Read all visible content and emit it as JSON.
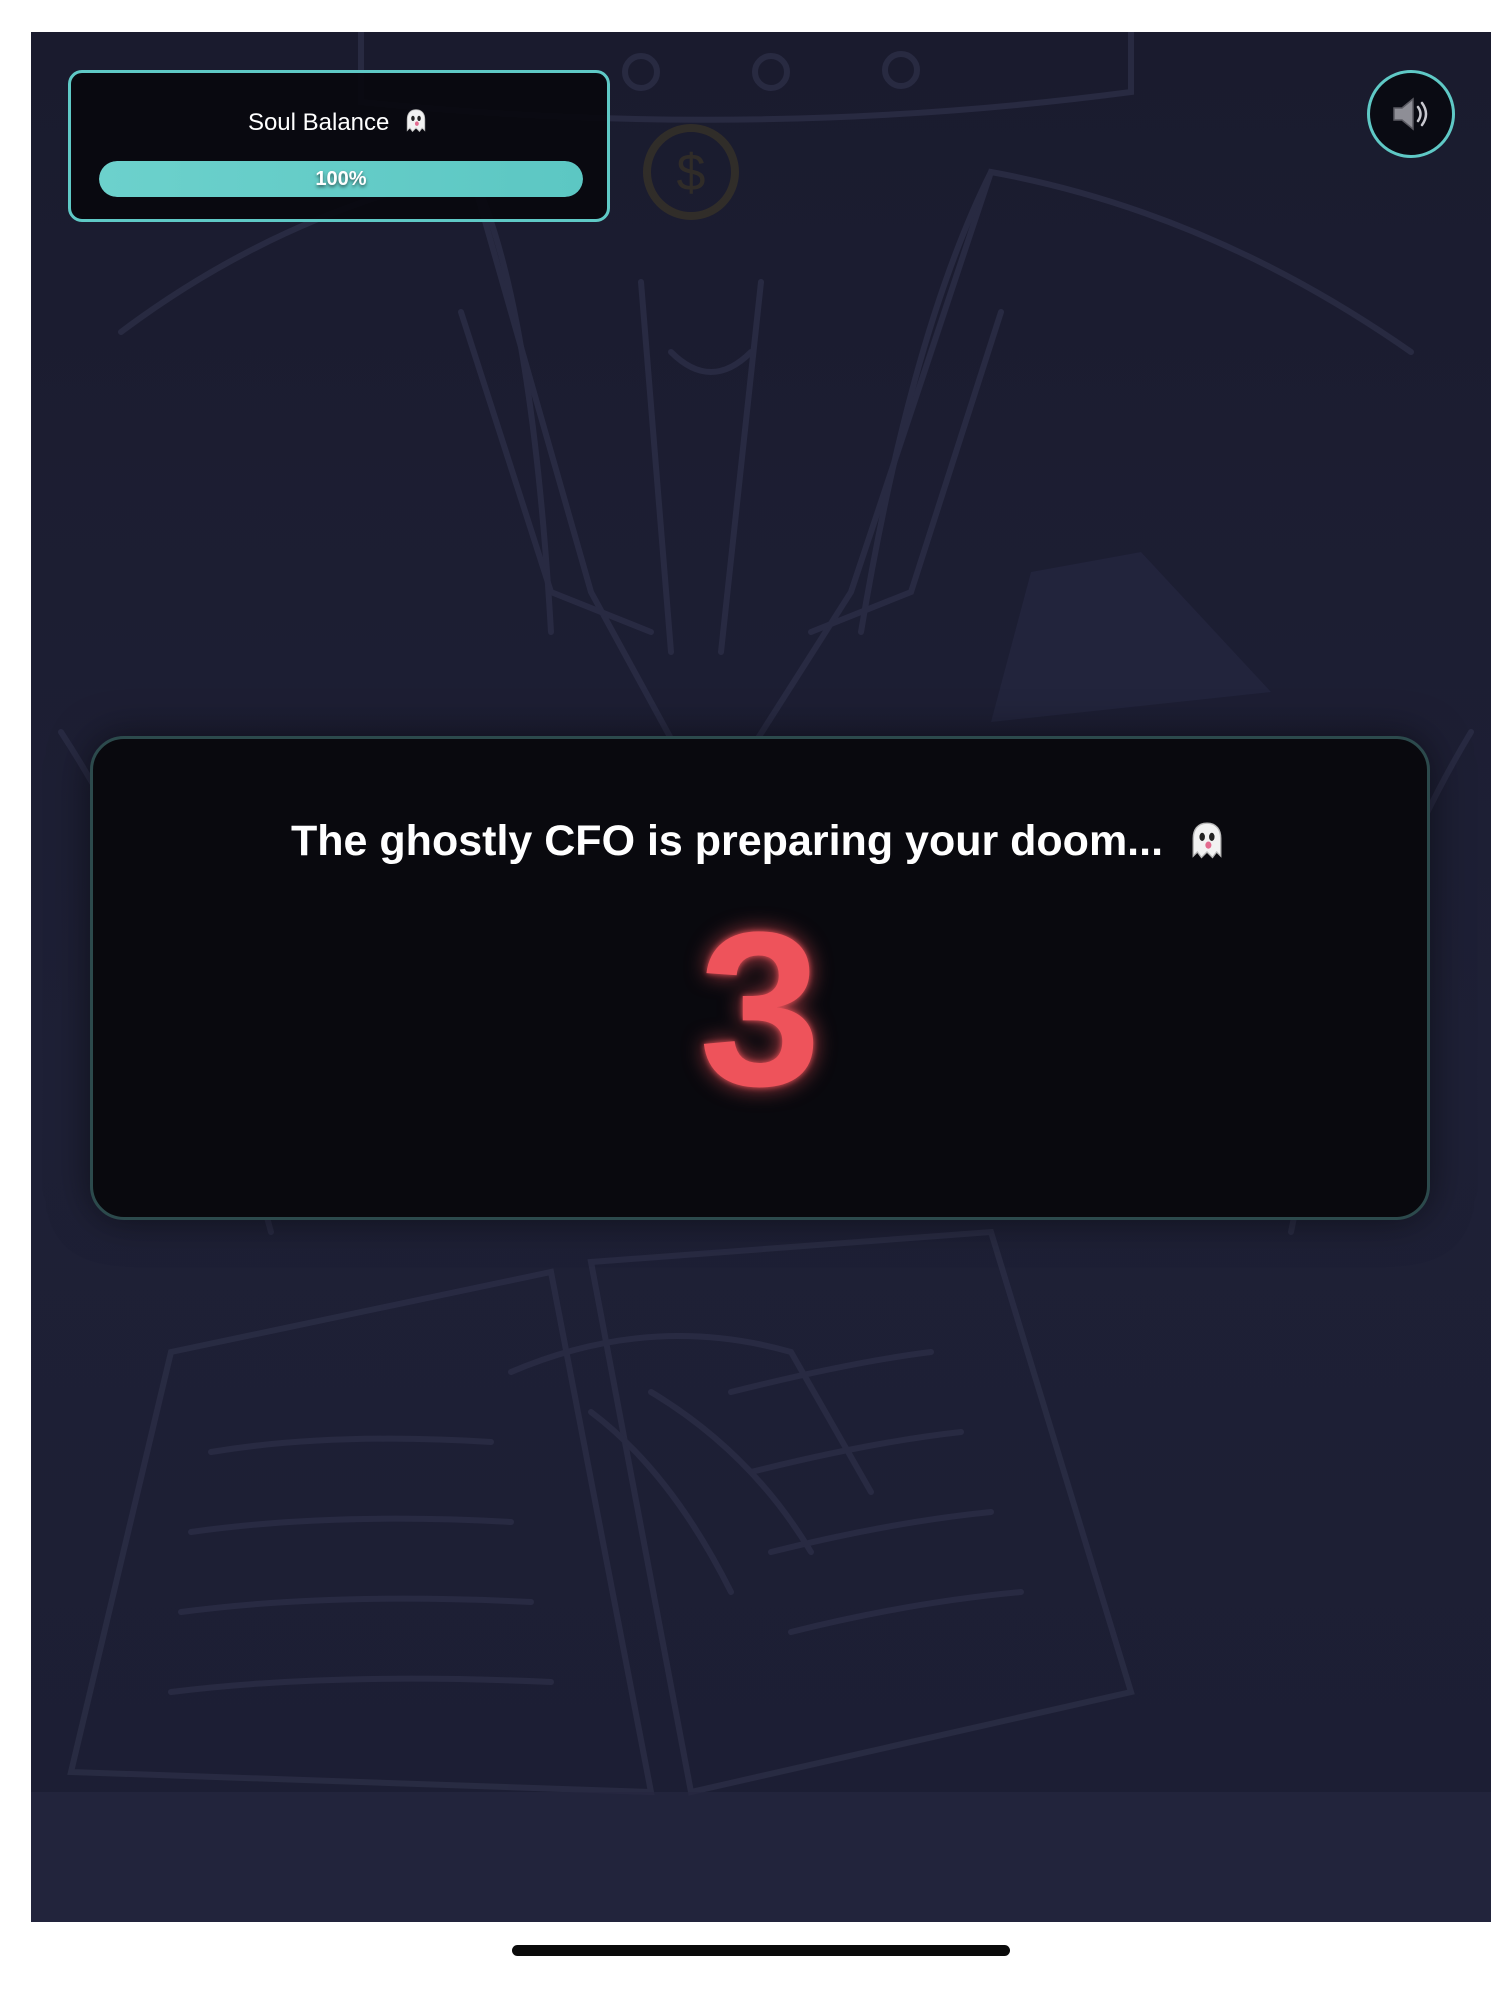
{
  "soul_balance": {
    "title": "Soul Balance",
    "icon": "ghost-icon",
    "percent_label": "100%",
    "percent_value": 100
  },
  "sound": {
    "icon": "speaker-icon"
  },
  "countdown_modal": {
    "message": "The ghostly CFO is preparing your doom...",
    "message_icon": "ghost-icon",
    "count": "3"
  },
  "colors": {
    "accent": "#5fc9c6",
    "countdown": "#ee535b",
    "background": "#1c1e33"
  }
}
